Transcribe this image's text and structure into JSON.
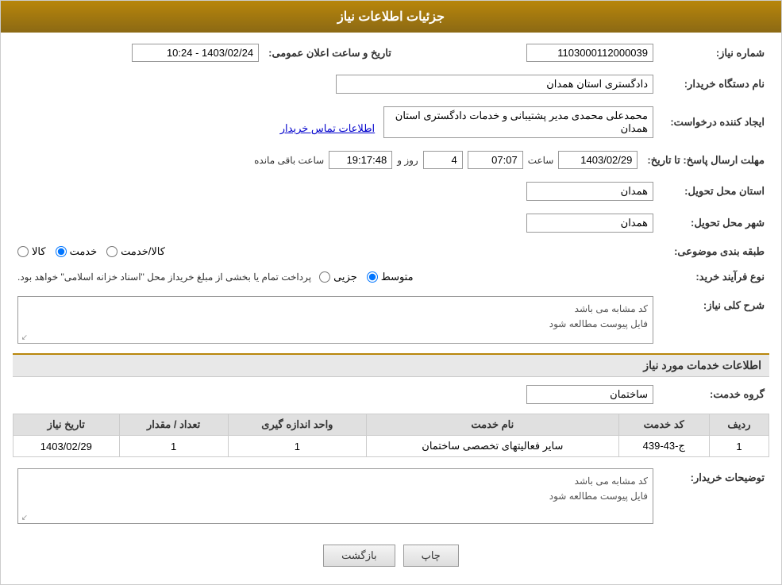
{
  "header": {
    "title": "جزئیات اطلاعات نیاز"
  },
  "fields": {
    "shomara_niaz_label": "شماره نیاز:",
    "shomara_niaz_value": "1103000112000039",
    "nam_dastgah_label": "نام دستگاه خریدار:",
    "nam_dastgah_value": "دادگستری استان همدان",
    "tarikh_elan_label": "تاریخ و ساعت اعلان عمومی:",
    "tarikh_elan_value": "1403/02/24 - 10:24",
    "ijad_konande_label": "ایجاد کننده درخواست:",
    "ijad_konande_value": "محمدعلی محمدی مدیر پشتیبانی و خدمات دادگستری استان همدان",
    "contact_link": "اطلاعات تماس خریدار",
    "mohlat_label": "مهلت ارسال پاسخ: تا تاریخ:",
    "mohlat_date": "1403/02/29",
    "mohlat_time_label": "ساعت",
    "mohlat_time": "07:07",
    "mohlat_roz_label": "روز و",
    "mohlat_roz": "4",
    "mohlat_saat_label": "ساعت باقی مانده",
    "mohlat_remaining": "19:17:48",
    "ostan_label": "استان محل تحویل:",
    "ostan_value": "همدان",
    "shahr_label": "شهر محل تحویل:",
    "shahr_value": "همدان",
    "tabaqe_label": "طبقه بندی موضوعی:",
    "tabaqe_options": [
      "کالا",
      "خدمت",
      "کالا/خدمت"
    ],
    "tabaqe_selected": "خدمت",
    "process_label": "نوع فرآیند خرید:",
    "process_options": [
      "جزیی",
      "متوسط"
    ],
    "process_selected": "متوسط",
    "process_desc": "پرداخت تمام یا بخشی از مبلغ خریداز محل \"اسناد خزانه اسلامی\" خواهد بود."
  },
  "sharh": {
    "section_title": "شرح کلی نیاز:",
    "line1": "کد مشابه می باشد",
    "line2": "فایل پیوست مطالعه شود"
  },
  "services_section": {
    "title": "اطلاعات خدمات مورد نیاز",
    "group_label": "گروه خدمت:",
    "group_value": "ساختمان",
    "table": {
      "headers": [
        "ردیف",
        "کد خدمت",
        "نام خدمت",
        "واحد اندازه گیری",
        "تعداد / مقدار",
        "تاریخ نیاز"
      ],
      "rows": [
        {
          "radif": "1",
          "kod": "ج-43-439",
          "naam": "سایر فعالیتهای تخصصی ساختمان",
          "vahed": "1",
          "tedad": "1",
          "tarikh": "1403/02/29"
        }
      ]
    }
  },
  "tozihat": {
    "section_label": "توضیحات خریدار:",
    "line1": "کد مشابه می باشد",
    "line2": "فایل پیوست مطالعه شود"
  },
  "buttons": {
    "chap": "چاپ",
    "bazgasht": "بازگشت"
  }
}
